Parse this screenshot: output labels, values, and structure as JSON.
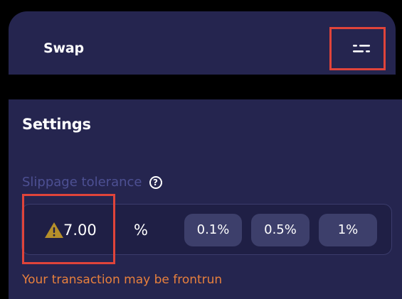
{
  "swap": {
    "title": "Swap",
    "settings_icon": "sliders-icon"
  },
  "settings": {
    "title": "Settings",
    "slippage_label": "Slippage tolerance",
    "help_icon": "question-circle-icon",
    "slippage_value": "7.00",
    "warning_icon": "warning-triangle-icon",
    "percent_symbol": "%",
    "presets": [
      "0.1%",
      "0.5%",
      "1%"
    ],
    "warning_text": "Your transaction may be frontrun"
  },
  "colors": {
    "panel_bg": "#25254f",
    "highlight": "#e0443a",
    "warning": "#e8803d",
    "muted_label": "#4d5093"
  }
}
